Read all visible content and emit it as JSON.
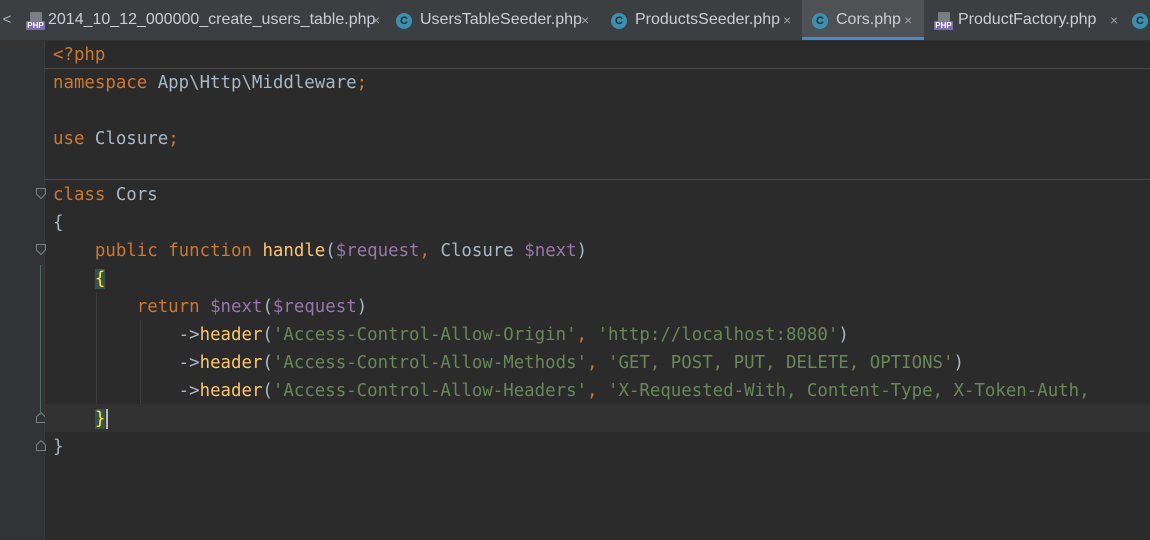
{
  "tabs": [
    {
      "label": "2014_10_12_000000_create_users_table.php",
      "icon": "php-file-icon",
      "icon_text": "PHP",
      "active": false
    },
    {
      "label": "UsersTableSeeder.php",
      "icon": "class-icon",
      "icon_text": "C",
      "active": false
    },
    {
      "label": "ProductsSeeder.php",
      "icon": "class-icon",
      "icon_text": "C",
      "active": false
    },
    {
      "label": "Cors.php",
      "icon": "class-icon",
      "icon_text": "C",
      "active": true
    },
    {
      "label": "ProductFactory.php",
      "icon": "php-file-icon",
      "icon_text": "PHP",
      "active": false
    },
    {
      "label": "",
      "icon": "class-icon",
      "icon_text": "C",
      "active": false
    }
  ],
  "close_glyph": "×",
  "scroll_left_glyph": "<",
  "code": {
    "line1": {
      "t0": "<?php"
    },
    "line2": {
      "t0": "namespace",
      "t1": " App\\Http\\Middleware",
      "t2": ";"
    },
    "line4": {
      "t0": "use",
      "t1": " Closure",
      "t2": ";"
    },
    "line6": {
      "t0": "class",
      "t1": " Cors"
    },
    "line7": {
      "t0": "{"
    },
    "line8": {
      "t0": "    ",
      "t1": "public",
      "t2": " ",
      "t3": "function",
      "t4": " ",
      "t5": "handle",
      "t6": "(",
      "t7": "$request",
      "t8": ", ",
      "t9": "Closure ",
      "t10": "$next",
      "t11": ")"
    },
    "line9": {
      "t0": "    ",
      "t1": "{"
    },
    "line10": {
      "t0": "        ",
      "t1": "return",
      "t2": " ",
      "t3": "$next",
      "t4": "(",
      "t5": "$request",
      "t6": ")"
    },
    "line11": {
      "t0": "            ->",
      "t1": "header",
      "t2": "(",
      "t3": "'Access-Control-Allow-Origin'",
      "t4": ", ",
      "t5": "'http://localhost:8080'",
      "t6": ")"
    },
    "line12": {
      "t0": "            ->",
      "t1": "header",
      "t2": "(",
      "t3": "'Access-Control-Allow-Methods'",
      "t4": ", ",
      "t5": "'GET, POST, PUT, DELETE, OPTIONS'",
      "t6": ")"
    },
    "line13": {
      "t0": "            ->",
      "t1": "header",
      "t2": "(",
      "t3": "'Access-Control-Allow-Headers'",
      "t4": ", ",
      "t5": "'X-Requested-With, Content-Type, X-Token-Auth, "
    },
    "line14": {
      "t0": "    ",
      "t1": "}"
    },
    "line15": {
      "t0": "}"
    }
  },
  "colors": {
    "keyword": "#cc7832",
    "function": "#ffc66d",
    "variable": "#9876aa",
    "string": "#6a8759",
    "text": "#a9b7c6",
    "active_tab_underline": "#4a88c7"
  }
}
